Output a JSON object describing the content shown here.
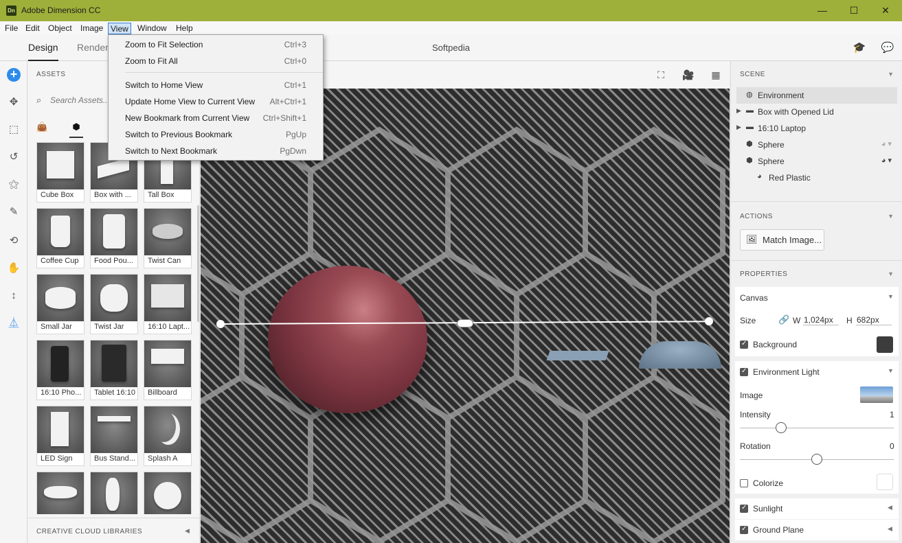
{
  "window": {
    "title": "Adobe Dimension CC",
    "app_icon": "Dn",
    "minimize": "—",
    "maximize": "☐",
    "close": "✕"
  },
  "menubar": [
    "File",
    "Edit",
    "Object",
    "Image",
    "View",
    "Window",
    "Help"
  ],
  "tabs": {
    "design": "Design",
    "render": "Render"
  },
  "doc_title": "Softpedia",
  "view_menu": [
    {
      "label": "Zoom to Fit Selection",
      "shortcut": "Ctrl+3"
    },
    {
      "label": "Zoom to Fit All",
      "shortcut": "Ctrl+0"
    },
    {
      "label": "Switch to Home View",
      "shortcut": "Ctrl+1"
    },
    {
      "label": "Update Home View to Current View",
      "shortcut": "Alt+Ctrl+1"
    },
    {
      "label": "New Bookmark from Current View",
      "shortcut": "Ctrl+Shift+1"
    },
    {
      "label": "Switch to Previous Bookmark",
      "shortcut": "PgUp"
    },
    {
      "label": "Switch to Next Bookmark",
      "shortcut": "PgDwn"
    }
  ],
  "assets": {
    "title": "ASSETS",
    "search_placeholder": "Search Assets...",
    "items": [
      "Cube Box",
      "Box with ...",
      "Tall Box",
      "Coffee Cup",
      "Food Pou...",
      "Twist Can",
      "Small Jar",
      "Twist Jar",
      "16:10 Lapt...",
      "16:10 Pho...",
      "Tablet 16:10",
      "Billboard",
      "LED Sign",
      "Bus Stand...",
      "Splash A",
      "",
      "",
      ""
    ],
    "libraries": "CREATIVE CLOUD LIBRARIES"
  },
  "scene": {
    "title": "SCENE",
    "items": [
      {
        "label": "Environment"
      },
      {
        "label": "Box with Opened Lid"
      },
      {
        "label": "16:10 Laptop"
      },
      {
        "label": "Sphere"
      },
      {
        "label": "Sphere"
      },
      {
        "label": "Red Plastic"
      }
    ]
  },
  "actions": {
    "title": "ACTIONS",
    "match_image": "Match Image..."
  },
  "properties": {
    "title": "PROPERTIES",
    "canvas": "Canvas",
    "size_label": "Size",
    "w_label": "W",
    "w_value": "1,024px",
    "h_label": "H",
    "h_value": "682px",
    "background": "Background",
    "background_color": "#3c3c3c",
    "env_light": "Environment Light",
    "image_label": "Image",
    "intensity_label": "Intensity",
    "intensity_value": "1",
    "rotation_label": "Rotation",
    "rotation_value": "0",
    "colorize": "Colorize",
    "sunlight": "Sunlight",
    "ground_plane": "Ground Plane"
  },
  "colors": {
    "titlebar": "#9fb03a",
    "accent": "#2d8ceb",
    "sphere": "#8a3d47"
  }
}
